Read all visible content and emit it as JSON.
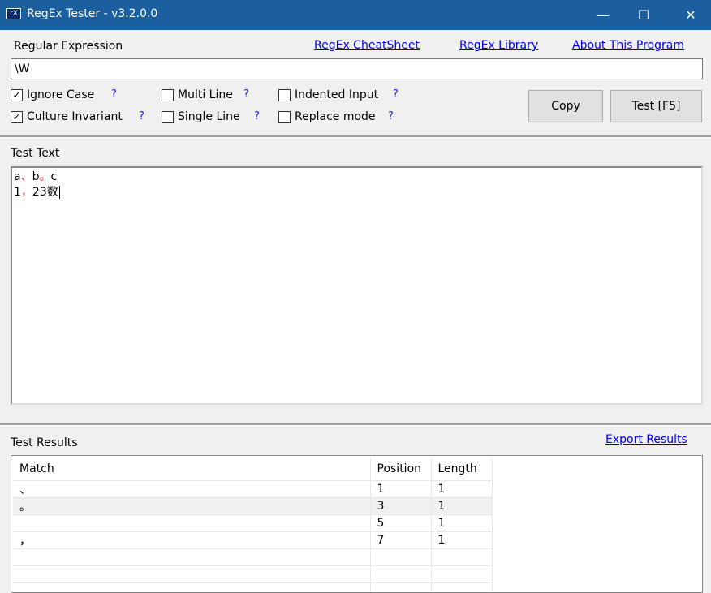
{
  "window": {
    "title": "RegEx Tester - v3.2.0.0",
    "icon_text": "rX",
    "minimize": "—",
    "maximize": "☐",
    "close": "✕"
  },
  "links": {
    "cheatsheet": "RegEx CheatSheet",
    "library": "RegEx Library",
    "about": "About This Program",
    "export": "Export Results"
  },
  "regex": {
    "label": "Regular Expression",
    "value": "\\W"
  },
  "options": [
    {
      "label": "Ignore Case",
      "checked": true
    },
    {
      "label": "Culture Invariant",
      "checked": true
    },
    {
      "label": "Multi Line",
      "checked": false
    },
    {
      "label": "Single Line",
      "checked": false
    },
    {
      "label": "Indented Input",
      "checked": false
    },
    {
      "label": "Replace mode",
      "checked": false
    }
  ],
  "help": "?",
  "buttons": {
    "copy": "Copy",
    "test": "Test [F5]"
  },
  "test_text": {
    "label": "Test Text",
    "line1": [
      "a",
      "、",
      "b",
      "。",
      "c"
    ],
    "line2": [
      "1",
      "，",
      "23数"
    ]
  },
  "results": {
    "label": "Test Results",
    "columns": [
      "Match",
      "Position",
      "Length"
    ],
    "rows": [
      [
        "、",
        "1",
        "1"
      ],
      [
        "。",
        "3",
        "1"
      ],
      [
        "",
        "5",
        "1"
      ],
      [
        "，",
        "7",
        "1"
      ],
      [
        "",
        "",
        ""
      ],
      [
        "",
        "",
        ""
      ],
      [
        "",
        "",
        ""
      ]
    ]
  },
  "colors": {
    "titlebar": "#1c5f9e",
    "match_highlight": "#ff3030"
  }
}
